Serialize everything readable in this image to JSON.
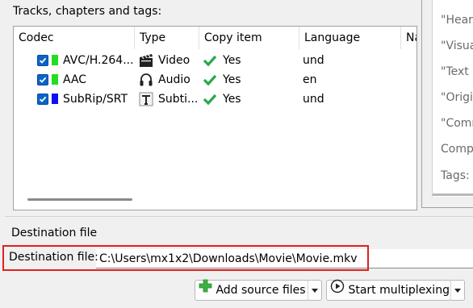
{
  "tracks": {
    "group_label": "Tracks, chapters and tags:",
    "columns": [
      "Codec",
      "Type",
      "Copy item",
      "Language",
      "Na"
    ],
    "rows": [
      {
        "codec": "AVC/H.264...",
        "type": "Video",
        "type_icon": "film-icon",
        "copy": "Yes",
        "language": "und",
        "swatch": "#22dd22",
        "checked": true
      },
      {
        "codec": "AAC",
        "type": "Audio",
        "type_icon": "headphones-icon",
        "copy": "Yes",
        "language": "en",
        "swatch": "#22dd22",
        "checked": true
      },
      {
        "codec": "SubRip/SRT",
        "type": "Subti...",
        "type_icon": "text-icon",
        "copy": "Yes",
        "language": "und",
        "swatch": "#1010ee",
        "checked": true
      }
    ]
  },
  "properties_panel": {
    "items": [
      "\"Heari",
      "\"Visua",
      "\"Text c",
      "\"Origi",
      "\"Comm",
      "Comp",
      "Tags:"
    ]
  },
  "destination": {
    "section_title": "Destination file",
    "label": "Destination file:",
    "path": "C:\\Users\\mx1x2\\Downloads\\Movie\\Movie.mkv"
  },
  "actions": {
    "add_source": "Add source files",
    "start_mux": "Start multiplexing"
  },
  "colors": {
    "highlight_frame": "#e02020",
    "checkbox": "#0a64c8",
    "checkmark_green": "#2aa84a"
  }
}
